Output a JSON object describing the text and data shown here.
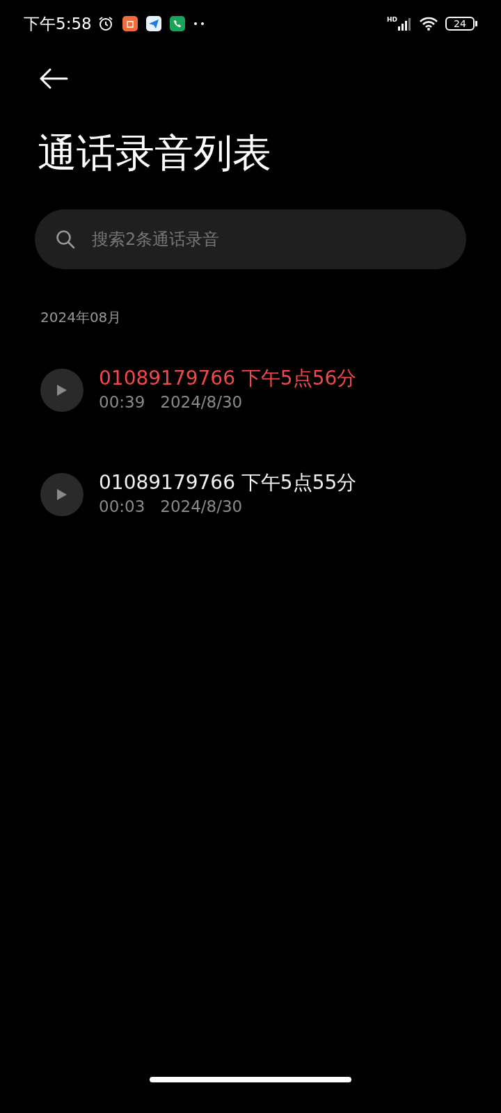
{
  "status_bar": {
    "time": "下午5:58",
    "network_label": "HD",
    "battery": "24"
  },
  "title": "通话录音列表",
  "search": {
    "placeholder": "搜索2条通话录音"
  },
  "sections": [
    {
      "header": "2024年08月",
      "recordings": [
        {
          "title": "01089179766 下午5点56分",
          "duration": "00:39",
          "date": "2024/8/30",
          "color": "#f2474b"
        },
        {
          "title": "01089179766 下午5点55分",
          "duration": "00:03",
          "date": "2024/8/30",
          "color": "#f2f2f2"
        }
      ]
    }
  ]
}
